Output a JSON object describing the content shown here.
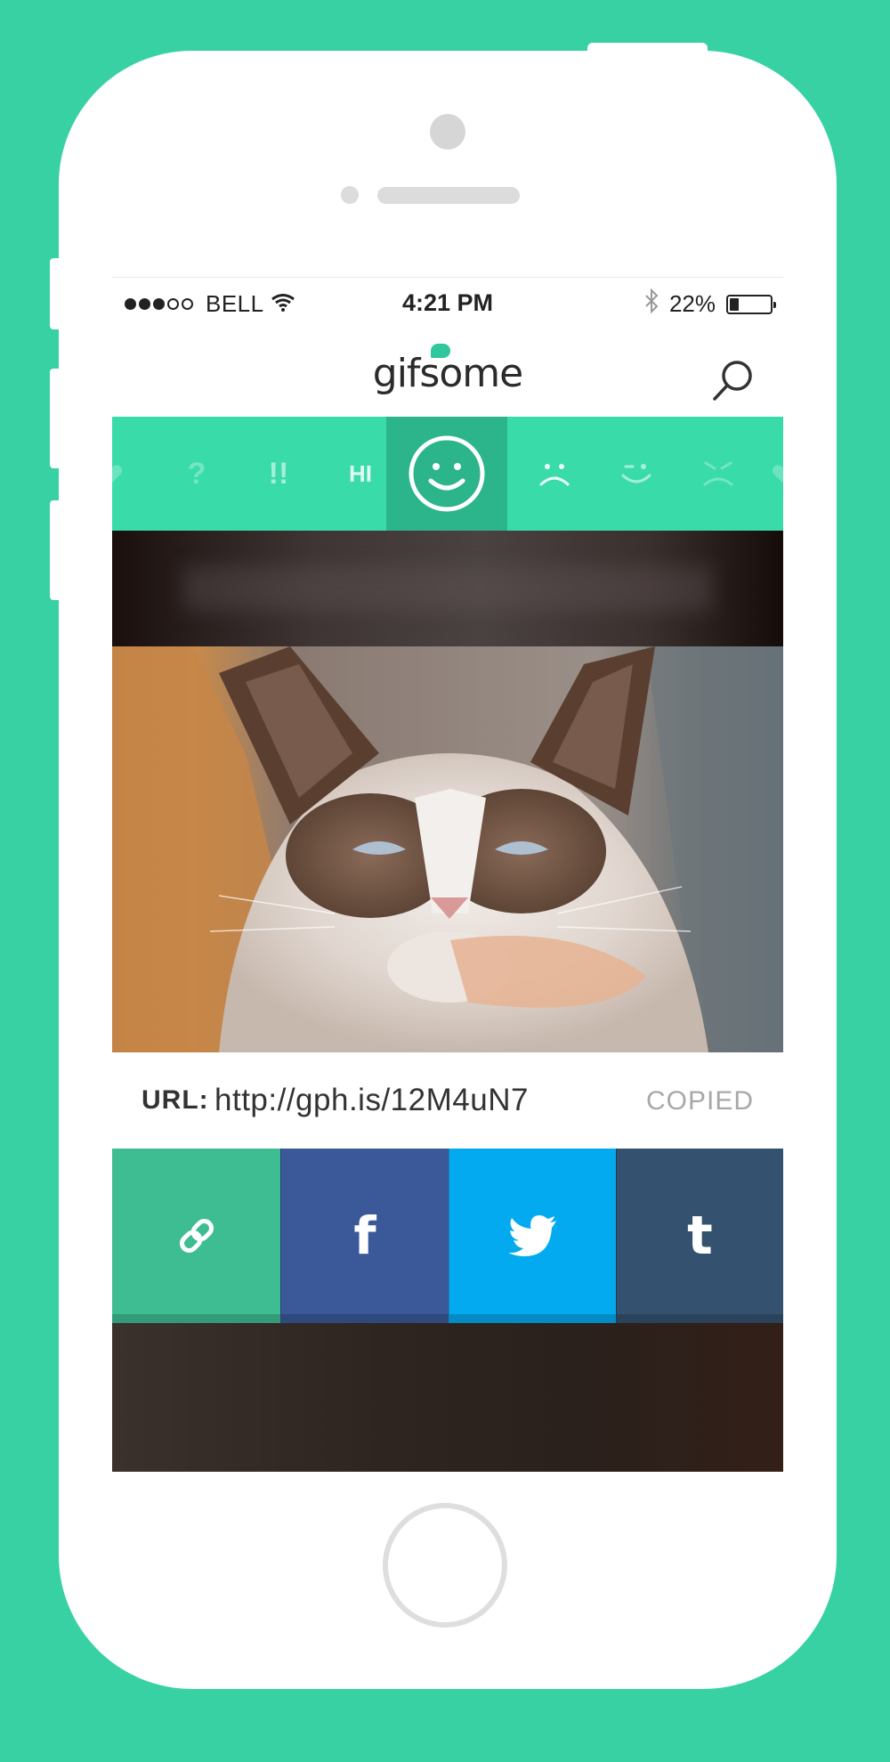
{
  "status_bar": {
    "carrier": "BELL",
    "time": "4:21 PM",
    "battery_text": "22%",
    "battery_level": 0.22,
    "signal_bars_filled": 3,
    "signal_bars_total": 5,
    "icons": [
      "wifi-icon",
      "bluetooth-icon",
      "battery-icon"
    ]
  },
  "header": {
    "logo_text": "gifsome",
    "search_icon": "search-icon"
  },
  "emoji_bar": {
    "items": [
      {
        "name": "heart",
        "label": ""
      },
      {
        "name": "question",
        "label": "?"
      },
      {
        "name": "exclaim",
        "label": "!!"
      },
      {
        "name": "hi",
        "label": "HI"
      },
      {
        "name": "smile",
        "label": "",
        "selected": true
      },
      {
        "name": "sad",
        "label": ""
      },
      {
        "name": "wink",
        "label": ""
      },
      {
        "name": "angry",
        "label": ""
      },
      {
        "name": "love",
        "label": ""
      }
    ]
  },
  "gif": {
    "description_icon": "grumpy-cat-gif"
  },
  "url_row": {
    "label": "URL:",
    "value": "http://gph.is/12M4uN7",
    "status": "COPIED"
  },
  "share_buttons": [
    {
      "name": "copy-link",
      "icon": "link-icon",
      "glyph": "",
      "color": "#3fbd92"
    },
    {
      "name": "facebook",
      "icon": "facebook-icon",
      "glyph": "f",
      "color": "#3b5998"
    },
    {
      "name": "twitter",
      "icon": "twitter-icon",
      "glyph": "",
      "color": "#03aaf0"
    },
    {
      "name": "tumblr",
      "icon": "tumblr-icon",
      "glyph": "t",
      "color": "#34526f"
    }
  ],
  "colors": {
    "background": "#37d1a4",
    "accent": "#39dba9",
    "accent_selected": "#2cb58a"
  }
}
